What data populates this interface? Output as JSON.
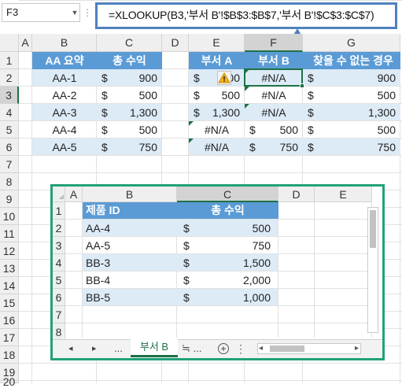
{
  "name_box": "F3",
  "formula": "=XLOOKUP(B3,'부서 B'!$B$3:$B$7,'부서 B'!$C$3:$C$7)",
  "colors": {
    "table_header": "#5b9bd5",
    "band": "#ddebf7",
    "callout_border": "#4f81bd",
    "window_border": "#21a179"
  },
  "main": {
    "col_headers": [
      "A",
      "B",
      "C",
      "D",
      "E",
      "F",
      "G"
    ],
    "row_headers": [
      "1",
      "2",
      "3",
      "4",
      "5",
      "6",
      "7",
      "8",
      "9",
      "10",
      "11",
      "12",
      "13",
      "14",
      "15",
      "16",
      "17",
      "18",
      "19",
      "20"
    ],
    "left_table": {
      "headers": [
        "AA 요약",
        "총 수익"
      ],
      "rows": [
        {
          "id": "AA-1",
          "cur": "$",
          "amt": "900"
        },
        {
          "id": "AA-2",
          "cur": "$",
          "amt": "500"
        },
        {
          "id": "AA-3",
          "cur": "$",
          "amt": "1,300"
        },
        {
          "id": "AA-4",
          "cur": "$",
          "amt": "500"
        },
        {
          "id": "AA-5",
          "cur": "$",
          "amt": "750"
        }
      ]
    },
    "right_table": {
      "headers": [
        "부서 A",
        "부서 B",
        "찾을 수 없는 경우"
      ],
      "rows": [
        {
          "a_cur": "$",
          "a_amt": "900",
          "b": "#N/A",
          "g_cur": "$",
          "g_amt": "900"
        },
        {
          "a_cur": "$",
          "a_amt": "500",
          "b": "#N/A",
          "g_cur": "$",
          "g_amt": "500"
        },
        {
          "a_cur": "$",
          "a_amt": "1,300",
          "b": "#N/A",
          "g_cur": "$",
          "g_amt": "1,300"
        },
        {
          "a": "#N/A",
          "b_cur": "$",
          "b_amt": "500",
          "g_cur": "$",
          "g_amt": "500"
        },
        {
          "a": "#N/A",
          "b_cur": "$",
          "b_amt": "750",
          "g_cur": "$",
          "g_amt": "750"
        }
      ]
    }
  },
  "window": {
    "col_headers": [
      "A",
      "B",
      "C",
      "D",
      "E"
    ],
    "row_headers": [
      "1",
      "2",
      "3",
      "4",
      "5",
      "6",
      "7",
      "8"
    ],
    "headers": [
      "제품 ID",
      "총 수익"
    ],
    "rows": [
      {
        "id": "AA-4",
        "cur": "$",
        "amt": "500"
      },
      {
        "id": "AA-5",
        "cur": "$",
        "amt": "750"
      },
      {
        "id": "BB-3",
        "cur": "$",
        "amt": "1,500"
      },
      {
        "id": "BB-4",
        "cur": "$",
        "amt": "2,000"
      },
      {
        "id": "BB-5",
        "cur": "$",
        "amt": "1,000"
      }
    ],
    "tabs": {
      "prev": "◂",
      "next": "▸",
      "more_left": "...",
      "active": "부서 B",
      "next_sheet": "≒ ...",
      "add": "+",
      "more_right": "⋮"
    },
    "hscroll_left": "◂",
    "hscroll_right": "▸"
  }
}
